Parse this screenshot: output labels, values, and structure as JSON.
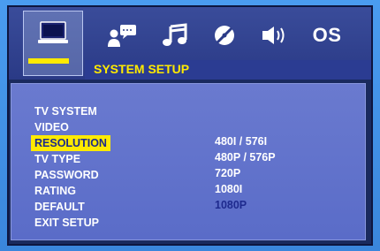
{
  "header": {
    "title": "SYSTEM SETUP"
  },
  "tabs": [
    {
      "icon": "monitor-icon",
      "active": true
    },
    {
      "icon": "user-chat-icon"
    },
    {
      "icon": "music-note-icon"
    },
    {
      "icon": "disc-icon"
    },
    {
      "icon": "speaker-icon"
    },
    {
      "icon": "os-text",
      "label": "OS"
    }
  ],
  "menu": {
    "items": [
      "TV SYSTEM",
      "VIDEO",
      "RESOLUTION",
      "TV TYPE",
      "PASSWORD",
      "RATING",
      "DEFAULT",
      "EXIT SETUP"
    ],
    "selected": "RESOLUTION"
  },
  "options": {
    "items": [
      "480I / 576I",
      "480P / 576P",
      "720P",
      "1080I",
      "1080P"
    ],
    "current": "1080P"
  },
  "colors": {
    "highlight": "#ffea00",
    "text": "#ffffff",
    "current_option": "#1e2a8e",
    "panel": "#5a6cc8"
  }
}
